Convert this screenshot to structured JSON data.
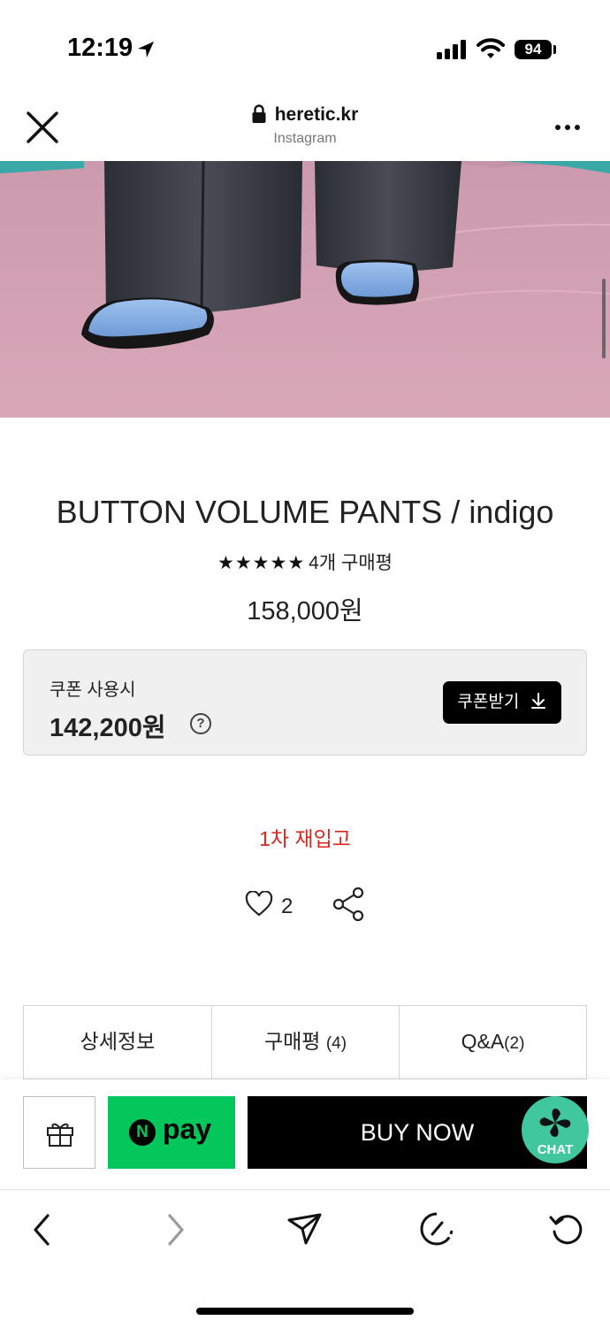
{
  "status_bar": {
    "time": "12:19",
    "battery": "94",
    "icons": [
      "location-arrow-icon",
      "cellular-signal-icon",
      "wifi-icon",
      "battery-icon"
    ]
  },
  "browser": {
    "url": "heretic.kr",
    "source": "Instagram",
    "icons": [
      "close-icon",
      "lock-icon",
      "more-icon"
    ]
  },
  "product": {
    "title": "BUTTON VOLUME PANTS / indigo",
    "stars": "★★★★★",
    "rating": 5,
    "review_count_text": "4개 구매평",
    "price": "158,000원"
  },
  "coupon": {
    "label": "쿠폰 사용시",
    "price": "142,200원",
    "help_glyph": "?",
    "button_label": "쿠폰받기"
  },
  "restock_text": "1차 재입고",
  "likes": {
    "count": "2"
  },
  "tabs": [
    {
      "label": "상세정보",
      "count": ""
    },
    {
      "label": "구매평",
      "count": "(4)"
    },
    {
      "label": "Q&A",
      "count": "(2)"
    }
  ],
  "actions": {
    "npay_logo_letter": "N",
    "npay_label": "pay",
    "buy_now": "BUY NOW",
    "chat": "CHAT"
  },
  "nav_icons": [
    "back-icon",
    "forward-icon",
    "share-send-icon",
    "speed-dial-icon",
    "reload-icon"
  ],
  "colors": {
    "accent_red": "#d9251d",
    "npay_green": "#03c75a",
    "chat_green": "#40c79d",
    "buy_black": "#000000"
  }
}
